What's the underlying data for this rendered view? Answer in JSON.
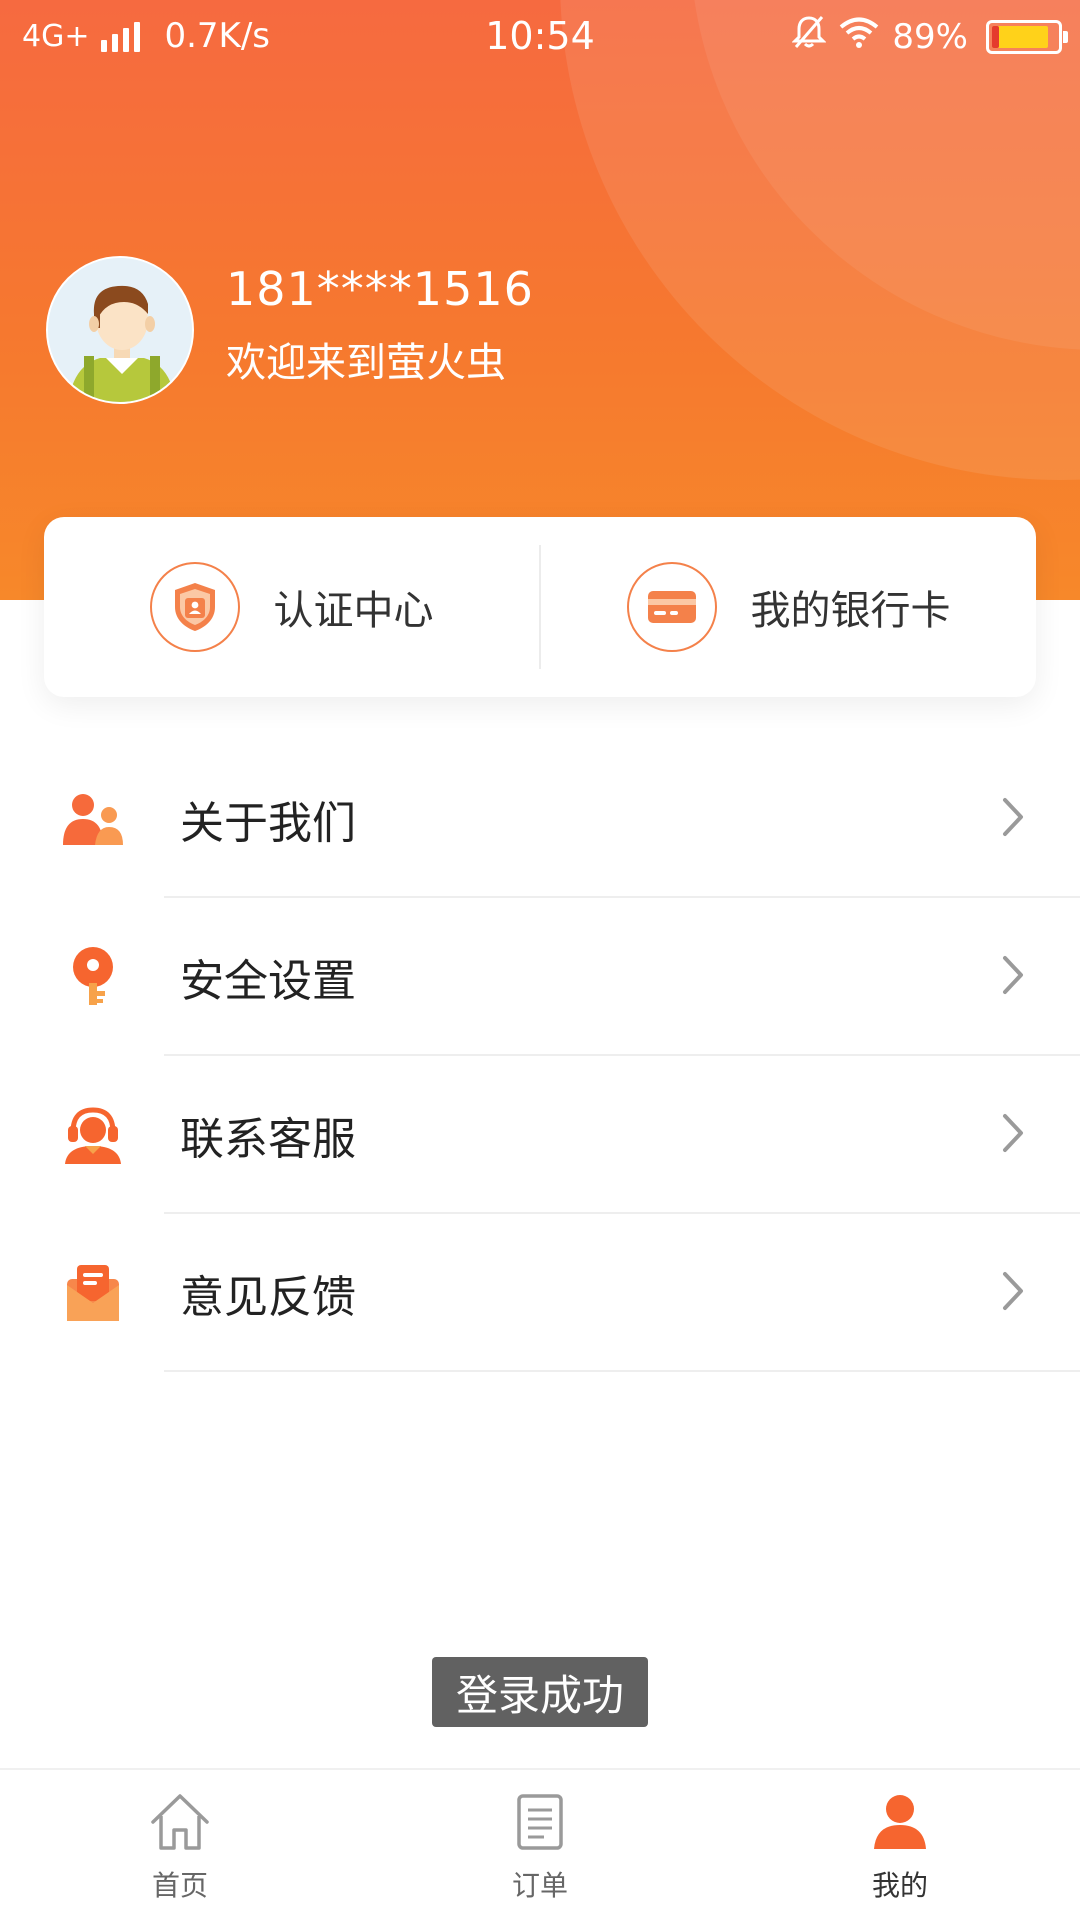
{
  "status_bar": {
    "network": "4G+",
    "speed": "0.7K/s",
    "time": "10:54",
    "battery": "89%"
  },
  "profile": {
    "phone": "181****1516",
    "welcome": "欢迎来到萤火虫"
  },
  "quick_actions": [
    {
      "label": "认证中心",
      "icon": "shield-icon"
    },
    {
      "label": "我的银行卡",
      "icon": "bank-card-icon"
    }
  ],
  "menu": [
    {
      "label": "关于我们",
      "icon": "people-icon"
    },
    {
      "label": "安全设置",
      "icon": "key-icon"
    },
    {
      "label": "联系客服",
      "icon": "headset-agent-icon"
    },
    {
      "label": "意见反馈",
      "icon": "feedback-mail-icon"
    }
  ],
  "toast": "登录成功",
  "tabbar": [
    {
      "label": "首页",
      "icon": "home-icon",
      "active": false
    },
    {
      "label": "订单",
      "icon": "order-document-icon",
      "active": false
    },
    {
      "label": "我的",
      "icon": "user-icon",
      "active": true
    }
  ],
  "colors": {
    "accent": "#f6782f",
    "header_top": "#f66a40",
    "header_bottom": "#f7882a"
  }
}
